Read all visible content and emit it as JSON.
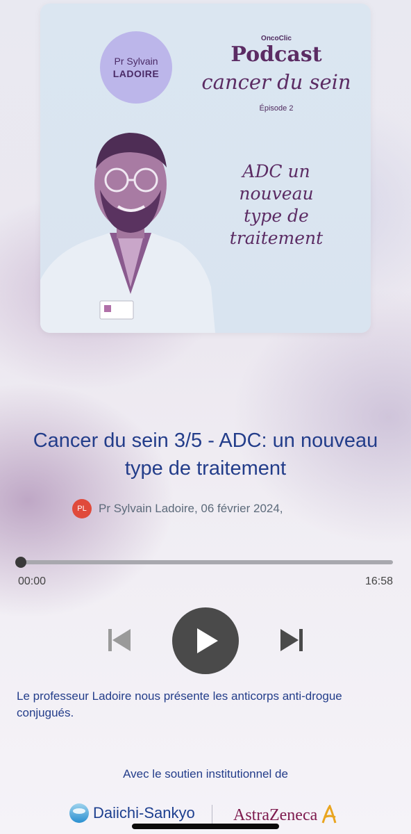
{
  "cover": {
    "badge_line1": "Pr Sylvain",
    "badge_line2": "LADOIRE",
    "brand": "OncoClic",
    "podcast": "Podcast",
    "series": "cancer du sein",
    "episode": "Épisode 2",
    "topic_lines": [
      "ADC un",
      "nouveau",
      "type de",
      "traitement"
    ]
  },
  "episode": {
    "title": "Cancer du sein 3/5 - ADC: un nouveau type de traitement",
    "author_initials": "PL",
    "author_date": "Pr Sylvain Ladoire, 06 février 2024,"
  },
  "player": {
    "progress": 0.0,
    "time_elapsed": "00:00",
    "time_total": "16:58"
  },
  "description": "Le professeur Ladoire nous présente les anticorps anti-drogue conjugués.",
  "support_text": "Avec le soutien institutionnel de",
  "sponsors": {
    "left": "Daiichi-Sankyo",
    "right": "AstraZeneca"
  },
  "colors": {
    "title_blue": "#233d8a",
    "avatar_red": "#e04a3b",
    "cover_purple": "#5b2b63",
    "badge_lavender": "#bcb6ea"
  }
}
